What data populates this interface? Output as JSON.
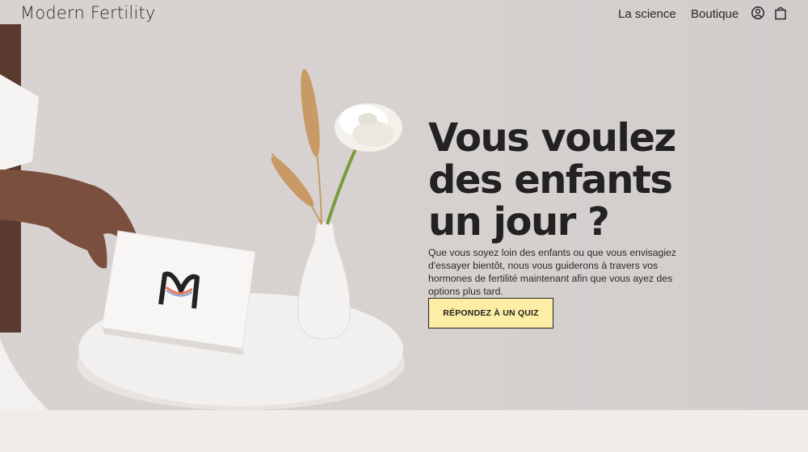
{
  "header": {
    "brand": "Modern Fertility",
    "nav": {
      "science": "La science",
      "shop": "Boutique"
    },
    "icons": {
      "account": "account-icon",
      "cart": "shopping-bag-icon"
    }
  },
  "hero": {
    "headline": "Vous voulez des enfants un jour ?",
    "body": "Que vous soyez loin des enfants ou que vous envisagiez d'essayer bientôt, nous vous guiderons à travers vos hormones de fertilité maintenant afin que vous ayez des options plus tard.",
    "cta_label": "RÉPONDEZ À UN QUIZ"
  },
  "colors": {
    "hero_bg": "#d8d3d1",
    "cta_bg": "#fdeea5",
    "text": "#222222",
    "band_bg": "#f0ecea"
  }
}
